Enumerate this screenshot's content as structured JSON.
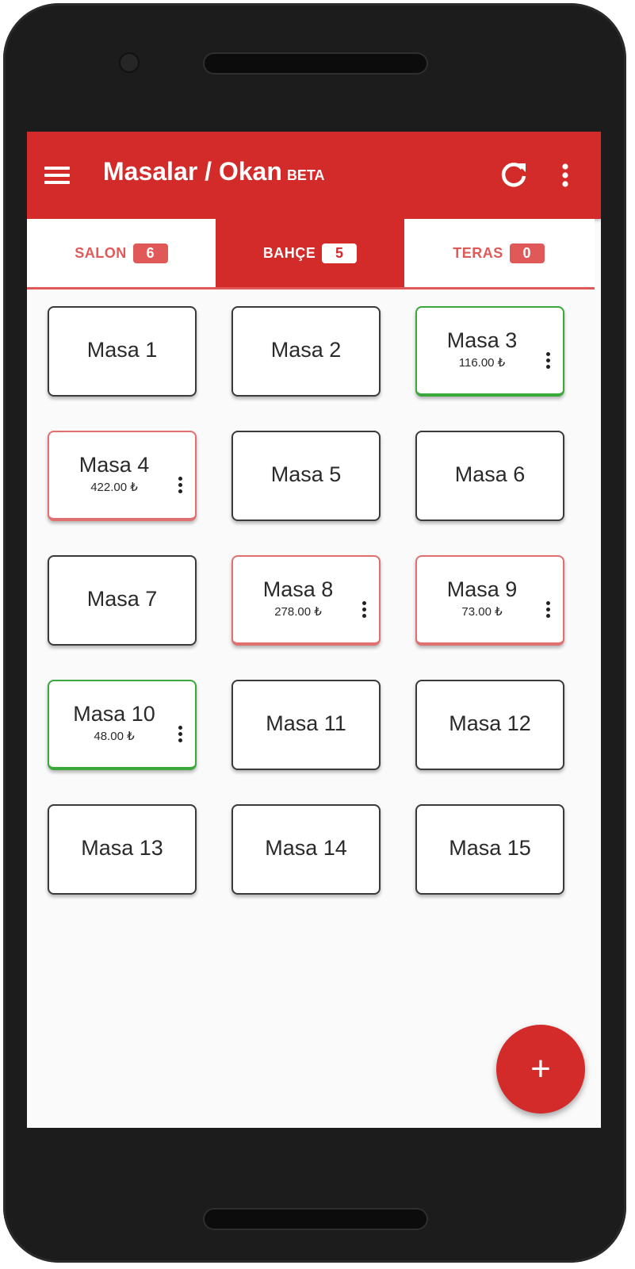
{
  "appbar": {
    "title": "Masalar / Okan",
    "badge": "BETA",
    "menu_icon": "hamburger-menu-icon",
    "refresh_icon": "refresh-icon",
    "overflow_icon": "more-vert-icon"
  },
  "tabs": [
    {
      "label": "SALON",
      "count": "6",
      "active": false
    },
    {
      "label": "BAHÇE",
      "count": "5",
      "active": true
    },
    {
      "label": "TERAS",
      "count": "0",
      "active": false
    }
  ],
  "tables": [
    {
      "name": "Masa 1",
      "amount": "",
      "status": "empty"
    },
    {
      "name": "Masa 2",
      "amount": "",
      "status": "empty"
    },
    {
      "name": "Masa 3",
      "amount": "116.00 ₺",
      "status": "green"
    },
    {
      "name": "Masa 4",
      "amount": "422.00 ₺",
      "status": "red"
    },
    {
      "name": "Masa 5",
      "amount": "",
      "status": "empty"
    },
    {
      "name": "Masa 6",
      "amount": "",
      "status": "empty"
    },
    {
      "name": "Masa 7",
      "amount": "",
      "status": "empty"
    },
    {
      "name": "Masa 8",
      "amount": "278.00 ₺",
      "status": "red"
    },
    {
      "name": "Masa 9",
      "amount": "73.00 ₺",
      "status": "red"
    },
    {
      "name": "Masa 10",
      "amount": "48.00 ₺",
      "status": "green"
    },
    {
      "name": "Masa 11",
      "amount": "",
      "status": "empty"
    },
    {
      "name": "Masa 12",
      "amount": "",
      "status": "empty"
    },
    {
      "name": "Masa 13",
      "amount": "",
      "status": "empty"
    },
    {
      "name": "Masa 14",
      "amount": "",
      "status": "empty"
    },
    {
      "name": "Masa 15",
      "amount": "",
      "status": "empty"
    }
  ],
  "fab": {
    "label": "+",
    "icon": "add-icon"
  },
  "colors": {
    "primary": "#d32a2a",
    "occupied_green": "#3aa83a",
    "occupied_red": "#e07070",
    "card_border": "#3a3a3a"
  }
}
